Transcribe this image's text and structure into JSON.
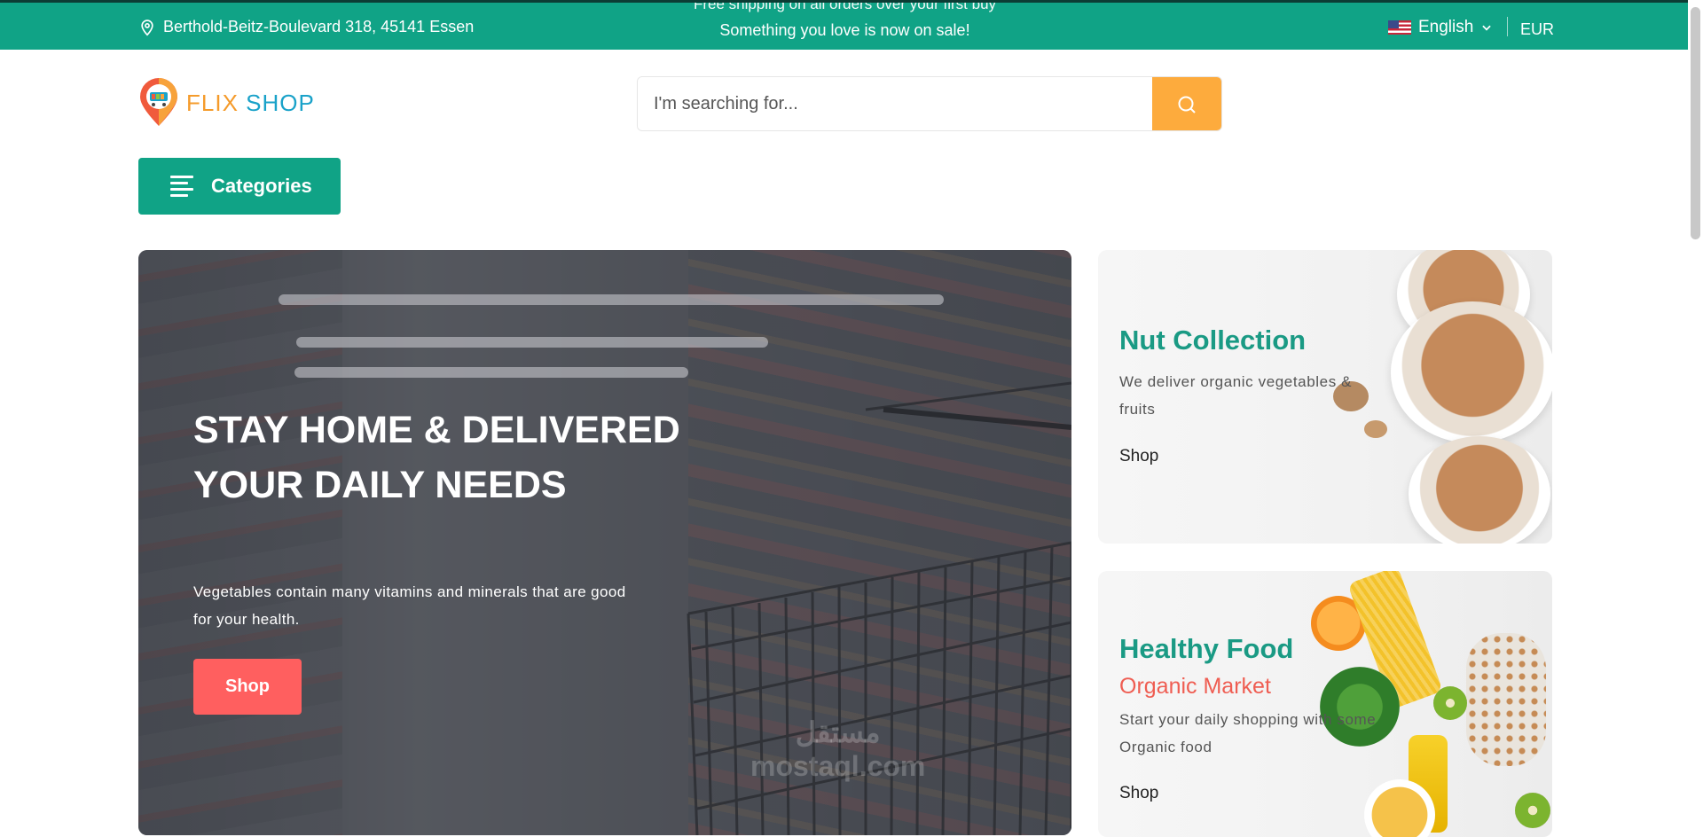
{
  "topbar": {
    "address": "Berthold-Beitz-Boulevard 318, 45141 Essen",
    "promo_previous": "Free shipping on all orders over your first buy",
    "promo": "Something you love is now on sale!",
    "language": "English",
    "currency": "EUR"
  },
  "brand": {
    "name_part1": "FLIX",
    "name_part2": "SHOP"
  },
  "search": {
    "placeholder": "I'm searching for..."
  },
  "categories_label": "Categories",
  "hero": {
    "heading": "STAY HOME & DELIVERED YOUR DAILY NEEDS",
    "text": "Vegetables contain many vitamins and minerals that are good for your health.",
    "button": "Shop",
    "watermark_line1": "مستقل",
    "watermark_line2": "mostaql.com"
  },
  "cards": [
    {
      "title": "Nut Collection",
      "description": "We deliver organic vegetables & fruits",
      "link": "Shop"
    },
    {
      "title": "Healthy Food",
      "subtitle": "Organic Market",
      "description": "Start your daily shopping with some Organic food",
      "link": "Shop"
    }
  ],
  "colors": {
    "primary": "#10a386",
    "accent_orange": "#fdab3d",
    "accent_red": "#ff5f5f",
    "card_title": "#1a9a84",
    "card_subtitle": "#ef5d52"
  },
  "icons": {
    "location": "location-pin-icon",
    "chevron": "chevron-down-icon",
    "search": "search-icon",
    "menu": "menu-icon"
  }
}
